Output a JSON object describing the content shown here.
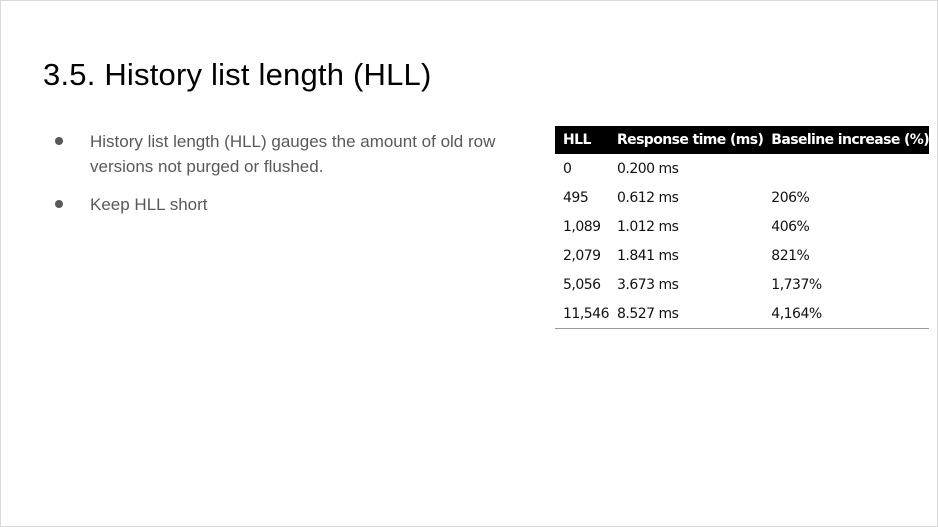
{
  "slide": {
    "title": "3.5. History list length (HLL)",
    "bullets": [
      "History list length (HLL) gauges the amount of old row versions not purged or flushed.",
      "Keep HLL short"
    ],
    "table": {
      "headers": [
        "HLL",
        "Response time (ms)",
        "Baseline increase (%)"
      ],
      "rows": [
        [
          "0",
          "0.200 ms",
          ""
        ],
        [
          "495",
          "0.612 ms",
          "206%"
        ],
        [
          "1,089",
          "1.012 ms",
          "406%"
        ],
        [
          "2,079",
          "1.841 ms",
          "821%"
        ],
        [
          "5,056",
          "3.673 ms",
          "1,737%"
        ],
        [
          "11,546",
          "8.527 ms",
          "4,164%"
        ]
      ]
    }
  }
}
